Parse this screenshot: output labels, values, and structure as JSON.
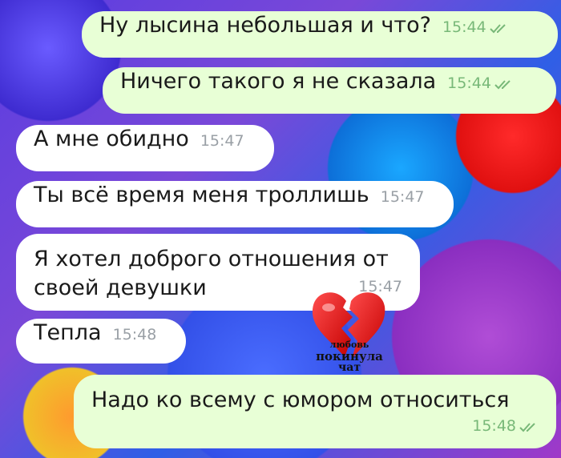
{
  "messages": [
    {
      "text": "Ну лысина небольшая и что?",
      "time": "15:44",
      "direction": "out",
      "read": true
    },
    {
      "text": "Ничего такого я не сказала",
      "time": "15:44",
      "direction": "out",
      "read": true
    },
    {
      "text": "А мне обидно",
      "time": "15:47",
      "direction": "in"
    },
    {
      "text": "Ты всё время меня троллишь",
      "time": "15:47",
      "direction": "in"
    },
    {
      "text": "Я хотел доброго отношения от\nсвоей девушки",
      "time": "15:47",
      "direction": "in"
    },
    {
      "text": "Тепла",
      "time": "15:48",
      "direction": "in"
    },
    {
      "text": "Надо ко всему с юмором относиться",
      "time": "15:48",
      "direction": "out",
      "read": true
    }
  ],
  "sticker": {
    "icon": "broken-heart-icon",
    "lines": [
      "любовь",
      "покинула",
      "чат"
    ]
  },
  "colors": {
    "incoming_bubble": "#ffffff",
    "outgoing_bubble": "#e8ffd6",
    "check_color": "#78b878"
  }
}
